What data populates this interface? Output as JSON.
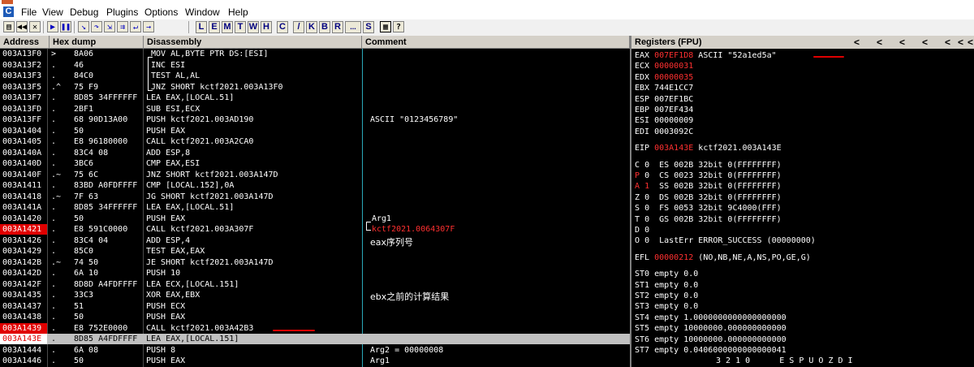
{
  "menu": [
    "File",
    "View",
    "Debug",
    "Plugins",
    "Options",
    "Window",
    "Help"
  ],
  "app_icon": "C",
  "toolbar": {
    "icon_buttons": [
      "open-icon",
      "rewind-icon",
      "close-icon",
      "play-icon",
      "pause-icon",
      "step-into-icon",
      "step-over-icon",
      "trace-into-icon",
      "trace-over-icon",
      "execute-till-return-icon",
      "goto-icon"
    ],
    "letter_buttons": [
      "L",
      "E",
      "M",
      "T",
      "W",
      "H",
      "C",
      "/",
      "K",
      "B",
      "R",
      "...",
      "S"
    ],
    "help_icon": "help-icon"
  },
  "cpu_headers": {
    "address": "Address",
    "hex": "Hex dump",
    "disasm": "Disassembly",
    "comment": "Comment"
  },
  "cpu_rows": [
    {
      "addr": "003A13F0",
      "mark": ">",
      "hex": "8A06",
      "dis": "MOV AL,BYTE PTR DS:[ESI]",
      "com": ""
    },
    {
      "addr": "003A13F2",
      "mark": ".",
      "hex": "46",
      "dis": "INC ESI",
      "com": ""
    },
    {
      "addr": "003A13F3",
      "mark": ".",
      "hex": "84C0",
      "dis": "TEST AL,AL",
      "com": ""
    },
    {
      "addr": "003A13F5",
      "mark": ".^",
      "hex": "75 F9",
      "dis": "JNZ SHORT kctf2021.003A13F0",
      "com": ""
    },
    {
      "addr": "003A13F7",
      "mark": ".",
      "hex": "8D85 34FFFFFF",
      "dis": "LEA EAX,[LOCAL.51]",
      "com": ""
    },
    {
      "addr": "003A13FD",
      "mark": ".",
      "hex": "2BF1",
      "dis": "SUB ESI,ECX",
      "com": ""
    },
    {
      "addr": "003A13FF",
      "mark": ".",
      "hex": "68 90D13A00",
      "dis": "PUSH kctf2021.003AD190",
      "com": "ASCII \"0123456789\""
    },
    {
      "addr": "003A1404",
      "mark": ".",
      "hex": "50",
      "dis": "PUSH EAX",
      "com": ""
    },
    {
      "addr": "003A1405",
      "mark": ".",
      "hex": "E8 96180000",
      "dis": "CALL kctf2021.003A2CA0",
      "com": ""
    },
    {
      "addr": "003A140A",
      "mark": ".",
      "hex": "83C4 08",
      "dis": "ADD ESP,8",
      "com": ""
    },
    {
      "addr": "003A140D",
      "mark": ".",
      "hex": "3BC6",
      "dis": "CMP EAX,ESI",
      "com": ""
    },
    {
      "addr": "003A140F",
      "mark": ".~",
      "hex": "75 6C",
      "dis": "JNZ SHORT kctf2021.003A147D",
      "com": ""
    },
    {
      "addr": "003A1411",
      "mark": ".",
      "hex": "83BD A0FDFFFF",
      "dis": "CMP [LOCAL.152],0A",
      "com": ""
    },
    {
      "addr": "003A1418",
      "mark": ".~",
      "hex": "7F 63",
      "dis": "JG SHORT kctf2021.003A147D",
      "com": ""
    },
    {
      "addr": "003A141A",
      "mark": ".",
      "hex": "8D85 34FFFFFF",
      "dis": "LEA EAX,[LOCAL.51]",
      "com": ""
    },
    {
      "addr": "003A1420",
      "mark": ".",
      "hex": "50",
      "dis": "PUSH EAX",
      "com": "Arg1"
    },
    {
      "addr": "003A1421",
      "mark": ".",
      "hex": "E8 591C0000",
      "dis": "CALL kctf2021.003A307F",
      "com": "kctf2021.0064307F"
    },
    {
      "addr": "003A1426",
      "mark": ".",
      "hex": "83C4 04",
      "dis": "ADD ESP,4",
      "com": "eax序列号"
    },
    {
      "addr": "003A1429",
      "mark": ".",
      "hex": "85C0",
      "dis": "TEST EAX,EAX",
      "com": ""
    },
    {
      "addr": "003A142B",
      "mark": ".~",
      "hex": "74 50",
      "dis": "JE SHORT kctf2021.003A147D",
      "com": ""
    },
    {
      "addr": "003A142D",
      "mark": ".",
      "hex": "6A 10",
      "dis": "PUSH 10",
      "com": ""
    },
    {
      "addr": "003A142F",
      "mark": ".",
      "hex": "8D8D A4FDFFFF",
      "dis": "LEA ECX,[LOCAL.151]",
      "com": ""
    },
    {
      "addr": "003A1435",
      "mark": ".",
      "hex": "33C3",
      "dis": "XOR EAX,EBX",
      "com": "ebx之前的计算结果"
    },
    {
      "addr": "003A1437",
      "mark": ".",
      "hex": "51",
      "dis": "PUSH ECX",
      "com": ""
    },
    {
      "addr": "003A1438",
      "mark": ".",
      "hex": "50",
      "dis": "PUSH EAX",
      "com": ""
    },
    {
      "addr": "003A1439",
      "mark": ".",
      "hex": "E8 752E0000",
      "dis": "CALL kctf2021.003A42B3",
      "com": ""
    },
    {
      "addr": "003A143E",
      "mark": ".",
      "hex": "8D85 A4FDFFFF",
      "dis": "LEA EAX,[LOCAL.151]",
      "com": ""
    },
    {
      "addr": "003A1444",
      "mark": ".",
      "hex": "6A 08",
      "dis": "PUSH 8",
      "com": "Arg2 = 00000008"
    },
    {
      "addr": "003A1446",
      "mark": ".",
      "hex": "50",
      "dis": "PUSH EAX",
      "com": "Arg1"
    }
  ],
  "registers": {
    "header": "Registers (FPU)",
    "header_arrows": [
      "<",
      "<",
      "<",
      "<",
      "<",
      "<",
      "<"
    ],
    "gp": [
      {
        "name": "EAX",
        "value": "007EF1D8",
        "extra": "ASCII \"52a1ed5a\""
      },
      {
        "name": "ECX",
        "value": "00000031",
        "extra": ""
      },
      {
        "name": "EDX",
        "value": "00000035",
        "extra": ""
      },
      {
        "name": "EBX",
        "value": "744E1CC7",
        "extra": ""
      },
      {
        "name": "ESP",
        "value": "007EF1BC",
        "extra": ""
      },
      {
        "name": "EBP",
        "value": "007EF434",
        "extra": ""
      },
      {
        "name": "ESI",
        "value": "00000009",
        "extra": ""
      },
      {
        "name": "EDI",
        "value": "0003092C",
        "extra": ""
      }
    ],
    "eip": {
      "name": "EIP",
      "value": "003A143E",
      "extra": "kctf2021.003A143E"
    },
    "flags": [
      {
        "f": "C",
        "v": "0",
        "seg": "ES 002B 32bit 0(FFFFFFFF)"
      },
      {
        "f": "P",
        "v": "0",
        "seg": "CS 0023 32bit 0(FFFFFFFF)"
      },
      {
        "f": "A",
        "v": "1",
        "seg": "SS 002B 32bit 0(FFFFFFFF)"
      },
      {
        "f": "Z",
        "v": "0",
        "seg": "DS 002B 32bit 0(FFFFFFFF)"
      },
      {
        "f": "S",
        "v": "0",
        "seg": "FS 0053 32bit 9C4000(FFF)"
      },
      {
        "f": "T",
        "v": "0",
        "seg": "GS 002B 32bit 0(FFFFFFFF)"
      },
      {
        "f": "D",
        "v": "0",
        "seg": ""
      },
      {
        "f": "O",
        "v": "0",
        "seg": "LastErr ERROR_SUCCESS (00000000)"
      }
    ],
    "efl": {
      "name": "EFL",
      "value": "00000212",
      "extra": "(NO,NB,NE,A,NS,PO,GE,G)"
    },
    "fpu": [
      "ST0 empty 0.0",
      "ST1 empty 0.0",
      "ST2 empty 0.0",
      "ST3 empty 0.0",
      "ST4 empty 1.0000000000000000000",
      "ST5 empty 10000000.000000000000",
      "ST6 empty 10000000.000000000000",
      "ST7 empty 0.0406000000000000041"
    ],
    "fpu_footer": "3 2 1 0      E S P U O Z D I"
  }
}
